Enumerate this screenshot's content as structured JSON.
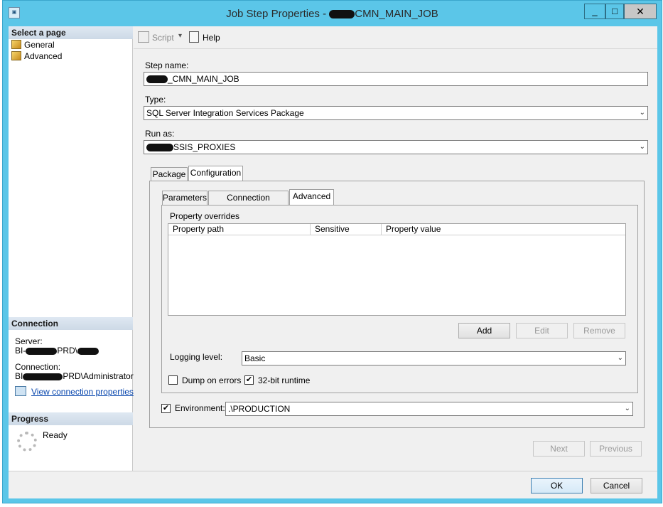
{
  "window": {
    "title_suffix": "CMN_MAIN_JOB",
    "title_prefix": "Job Step Properties - ",
    "minimize": "_",
    "maximize": "□",
    "close": "✕"
  },
  "left_pane": {
    "select_page_header": "Select a page",
    "pages": [
      {
        "label": "General",
        "icon": "page-icon"
      },
      {
        "label": "Advanced",
        "icon": "page-icon"
      }
    ],
    "connection_header": "Connection",
    "server_label": "Server:",
    "server_value_prefix": "BI-",
    "server_value_mid": "PRD\\",
    "connection_label": "Connection:",
    "connection_value_prefix": "BI",
    "connection_value_suffix": "PRD\\Administrator",
    "view_connection_link": "View connection properties",
    "progress_header": "Progress",
    "progress_status": "Ready"
  },
  "toolbar": {
    "script_label": "Script",
    "help_label": "Help"
  },
  "form": {
    "step_name_label": "Step name:",
    "step_name_value": "_CMN_MAIN_JOB",
    "type_label": "Type:",
    "type_value": "SQL Server Integration Services Package",
    "run_as_label": "Run as:",
    "run_as_value": "SSIS_PROXIES"
  },
  "outer_tabs": [
    {
      "label": "Package",
      "active": false
    },
    {
      "label": "Configuration",
      "active": true
    }
  ],
  "inner_tabs": [
    {
      "label": "Parameters",
      "active": false
    },
    {
      "label": "Connection Managers",
      "active": false
    },
    {
      "label": "Advanced",
      "active": true
    }
  ],
  "advanced": {
    "property_overrides_label": "Property overrides",
    "columns": [
      "Property path",
      "Sensitive",
      "Property value"
    ],
    "add_label": "Add",
    "edit_label": "Edit",
    "remove_label": "Remove",
    "logging_level_label": "Logging level:",
    "logging_level_value": "Basic",
    "dump_on_errors_label": "Dump on errors",
    "dump_on_errors_checked": false,
    "runtime_32bit_label": "32-bit runtime",
    "runtime_32bit_checked": true
  },
  "environment": {
    "label": "Environment:",
    "checked": true,
    "value": ".\\PRODUCTION"
  },
  "nav": {
    "next_label": "Next",
    "previous_label": "Previous"
  },
  "footer": {
    "ok_label": "OK",
    "cancel_label": "Cancel"
  },
  "glyphs": {
    "check": "✔",
    "dropdown": "⌄",
    "caret": "▾"
  }
}
